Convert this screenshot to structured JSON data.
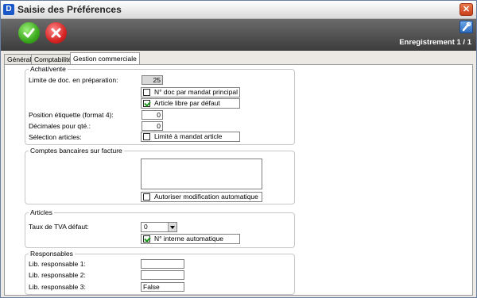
{
  "window": {
    "title": "Saisie des Préférences",
    "app_icon_glyph": "D"
  },
  "toolbar": {
    "record_label": "Enregistrement 1 / 1"
  },
  "tabs": [
    {
      "label": "Général"
    },
    {
      "label": "Comptabilité"
    },
    {
      "label": "Gestion commerciale"
    }
  ],
  "achat_vente": {
    "title": "Achat/vente",
    "limite_label": "Limite de doc. en préparation:",
    "limite_value": "25",
    "doc_par_mandat": {
      "label": "N° doc par mandat principal",
      "checked": false
    },
    "article_libre": {
      "label": "Article libre par défaut",
      "checked": true
    },
    "position_label": "Position étiquette (format 4):",
    "position_value": "0",
    "decimales_label": "Décimales pour qté.:",
    "decimales_value": "0",
    "selection_label": "Sélection articles:",
    "limite_mandat": {
      "label": "Limité à mandat article",
      "checked": false
    }
  },
  "comptes": {
    "title": "Comptes bancaires sur facture",
    "auto_modif": {
      "label": "Autoriser modification automatique",
      "checked": false
    }
  },
  "articles": {
    "title": "Articles",
    "tva_label": "Taux de TVA défaut:",
    "tva_value": "0",
    "interne_auto": {
      "label": "N° interne automatique",
      "checked": true
    }
  },
  "responsables": {
    "title": "Responsables",
    "lib1_label": "Lib. responsable 1:",
    "lib1_value": "",
    "lib2_label": "Lib. responsable 2:",
    "lib2_value": "",
    "lib3_label": "Lib. responsable 3:",
    "lib3_value": "False"
  }
}
